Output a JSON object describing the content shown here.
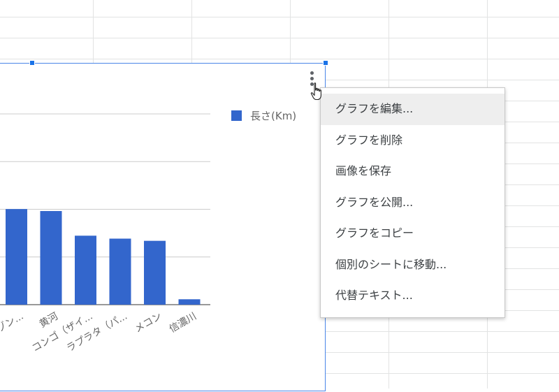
{
  "chart_data": {
    "type": "bar",
    "categories": [
      "アマゾン...",
      "黄河",
      "コンゴ（ザイ...",
      "ラプラタ（パ...",
      "メコン",
      "信濃川"
    ],
    "values": [
      6516,
      6380,
      4700,
      4500,
      4350,
      367
    ],
    "legend": [
      {
        "name": "長さ(Km)",
        "color": "#3366cc"
      }
    ],
    "series": [
      {
        "name": "長さ(Km)",
        "values": [
          6516,
          6380,
          4700,
          4500,
          4350,
          367
        ]
      }
    ],
    "ylim": [
      0,
      13000
    ],
    "grid": true,
    "legend_position": "top-right",
    "bar_color": "#3366cc",
    "title": "",
    "xlabel": "",
    "ylabel": ""
  },
  "menu": {
    "items": [
      {
        "label": "グラフを編集...",
        "highlighted": true
      },
      {
        "label": "グラフを削除"
      },
      {
        "label": "画像を保存"
      },
      {
        "label": "グラフを公開..."
      },
      {
        "label": "グラフをコピー"
      },
      {
        "label": "個別のシートに移動..."
      },
      {
        "label": "代替テキスト..."
      }
    ]
  },
  "icons": {
    "chart_menu": "more-vert-icon",
    "cursor": "hand-pointer-icon"
  },
  "colors": {
    "selection_border": "#4a86e8",
    "handle": "#1a73e8",
    "menu_highlight": "#eeeeee"
  }
}
